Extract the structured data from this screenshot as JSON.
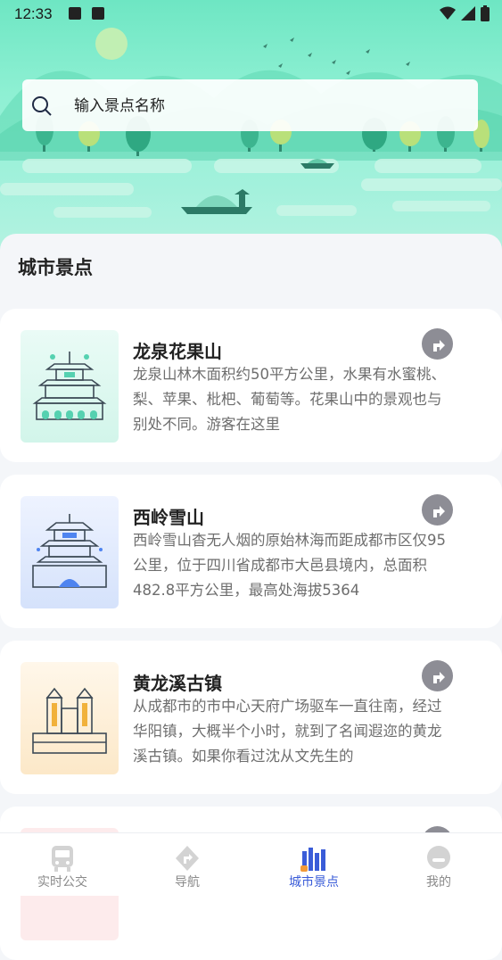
{
  "status_bar": {
    "time": "12:33"
  },
  "search": {
    "placeholder": "输入景点名称",
    "icon": "search-icon"
  },
  "section": {
    "title": "城市景点"
  },
  "colors": {
    "accent": "#3a5cd8",
    "hero": "#7eebcb",
    "nav_button": "#8d8d95"
  },
  "spots": [
    {
      "name": "龙泉花果山",
      "description": "龙泉山林木面积约50平方公里，水果有水蜜桃、梨、苹果、枇杷、葡萄等。花果山中的景观也与别处不同。游客在这里",
      "thumb_icon": "palace-icon"
    },
    {
      "name": "西岭雪山",
      "description": "西岭雪山杳无人烟的原始林海而距成都市区仅95公里，位于四川省成都市大邑县境内，总面积482.8平方公里，最高处海拔5364",
      "thumb_icon": "tower-icon"
    },
    {
      "name": "黄龙溪古镇",
      "description": "从成都市的市中心天府广场驱车一直往南，经过华阳镇，大概半个小时，就到了名闻遐迩的黄龙溪古镇。如果你看过沈从文先生的",
      "thumb_icon": "gate-icon"
    }
  ],
  "tabs": [
    {
      "label": "实时公交",
      "icon": "bus-icon",
      "active": false
    },
    {
      "label": "导航",
      "icon": "navigation-icon",
      "active": false
    },
    {
      "label": "城市景点",
      "icon": "city-icon",
      "active": true
    },
    {
      "label": "我的",
      "icon": "profile-icon",
      "active": false
    }
  ]
}
